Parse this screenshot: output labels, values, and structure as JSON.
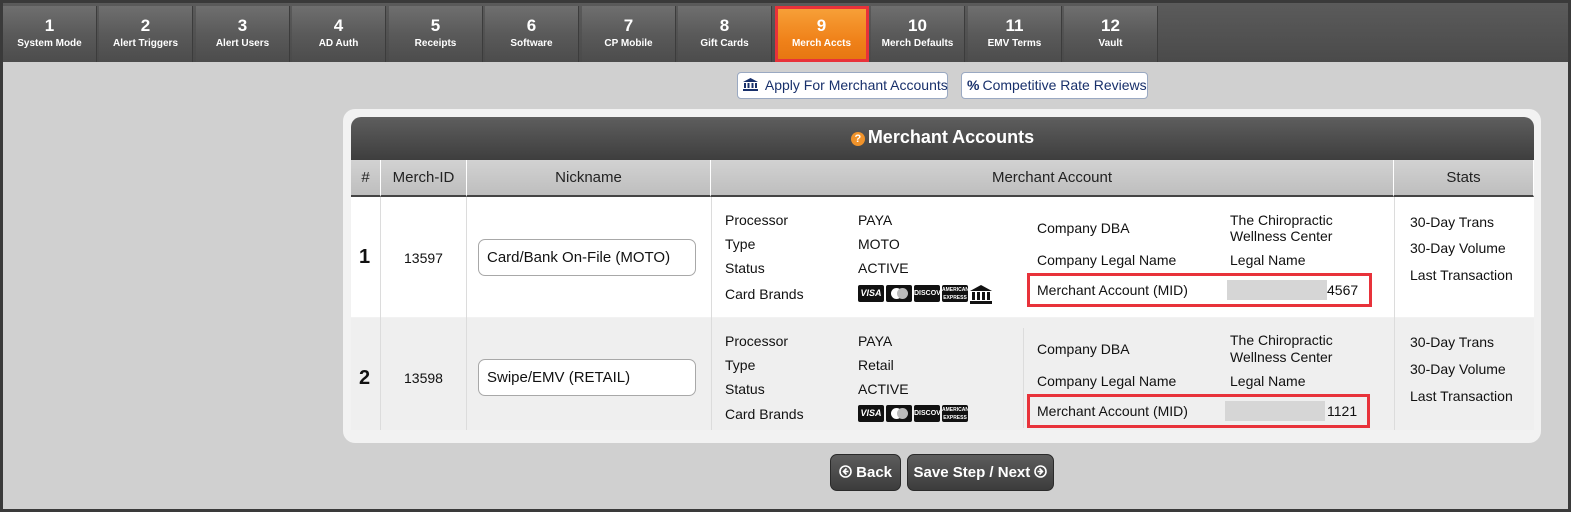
{
  "steps": [
    {
      "num": "1",
      "label": "System Mode"
    },
    {
      "num": "2",
      "label": "Alert Triggers"
    },
    {
      "num": "3",
      "label": "Alert Users"
    },
    {
      "num": "4",
      "label": "AD Auth"
    },
    {
      "num": "5",
      "label": "Receipts"
    },
    {
      "num": "6",
      "label": "Software"
    },
    {
      "num": "7",
      "label": "CP Mobile"
    },
    {
      "num": "8",
      "label": "Gift Cards"
    },
    {
      "num": "9",
      "label": "Merch Accts"
    },
    {
      "num": "10",
      "label": "Merch Defaults"
    },
    {
      "num": "11",
      "label": "EMV Terms"
    },
    {
      "num": "12",
      "label": "Vault"
    }
  ],
  "active_step": "9",
  "links": {
    "apply": "Apply For Merchant Accounts",
    "rates": "Competitive Rate Reviews"
  },
  "panel": {
    "title": "Merchant Accounts",
    "columns": {
      "num": "#",
      "merch_id": "Merch-ID",
      "nickname": "Nickname",
      "merchant_account": "Merchant Account",
      "stats": "Stats"
    }
  },
  "labels": {
    "processor": "Processor",
    "type": "Type",
    "status": "Status",
    "card_brands": "Card Brands",
    "company_dba": "Company DBA",
    "company_legal": "Company Legal Name",
    "mid": "Merchant Account (MID)",
    "trans": "30-Day Trans",
    "volume": "30-Day Volume",
    "last": "Last Transaction"
  },
  "brand_marks": {
    "visa": "VISA",
    "discover": "DISCOVER",
    "amex": "AMERICAN EXPRESS"
  },
  "rows": [
    {
      "num": "1",
      "merch_id": "13597",
      "nickname": "Card/Bank On-File (MOTO)",
      "processor": "PAYA",
      "type": "MOTO",
      "status": "ACTIVE",
      "dba_line1": "The Chiropractic",
      "dba_line2": "Wellness Center",
      "legal": "Legal Name",
      "mid_suffix": "4567",
      "brands": [
        "visa-icon",
        "mastercard-icon",
        "discover-icon",
        "amex-icon",
        "bank-icon"
      ]
    },
    {
      "num": "2",
      "merch_id": "13598",
      "nickname": "Swipe/EMV (RETAIL)",
      "processor": "PAYA",
      "type": "Retail",
      "status": "ACTIVE",
      "dba_line1": "The Chiropractic",
      "dba_line2": "Wellness Center",
      "legal": "Legal Name",
      "mid_suffix": "1121",
      "brands": [
        "visa-icon",
        "mastercard-icon",
        "discover-icon",
        "amex-icon"
      ]
    }
  ],
  "buttons": {
    "back": "Back",
    "next": "Save Step / Next"
  },
  "colors": {
    "active_step": "#f0821a",
    "highlight": "#e8323a",
    "link_text": "#18306b"
  }
}
